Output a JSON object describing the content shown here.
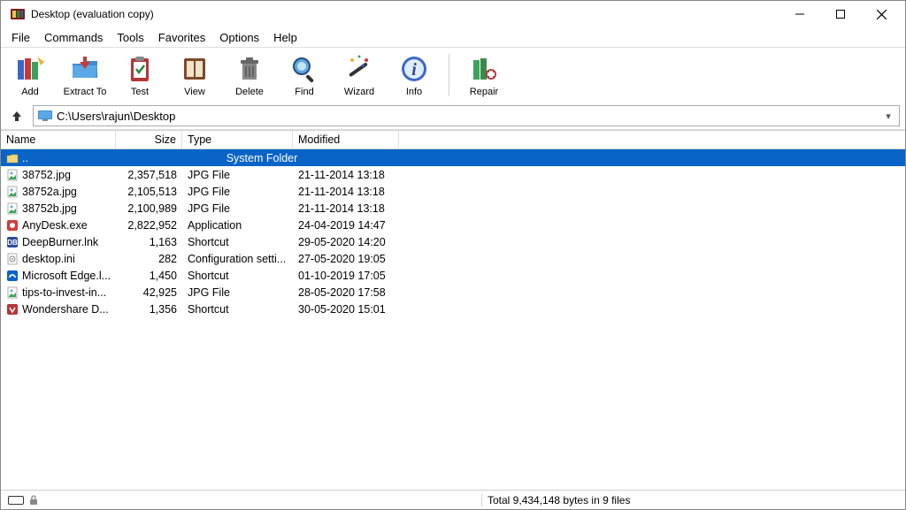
{
  "titlebar": {
    "title": "Desktop (evaluation copy)"
  },
  "menu": {
    "file": "File",
    "commands": "Commands",
    "tools": "Tools",
    "favorites": "Favorites",
    "options": "Options",
    "help": "Help"
  },
  "toolbar": {
    "add": "Add",
    "extract": "Extract To",
    "test": "Test",
    "view": "View",
    "delete": "Delete",
    "find": "Find",
    "wizard": "Wizard",
    "info": "Info",
    "repair": "Repair"
  },
  "path": "C:\\Users\\rajun\\Desktop",
  "columns": {
    "name": "Name",
    "size": "Size",
    "type": "Type",
    "modified": "Modified"
  },
  "parent_row": {
    "name": "..",
    "type": "System Folder"
  },
  "files": [
    {
      "icon": "jpg",
      "name": "38752.jpg",
      "size": "2,357,518",
      "type": "JPG File",
      "modified": "21-11-2014 13:18"
    },
    {
      "icon": "jpg",
      "name": "38752a.jpg",
      "size": "2,105,513",
      "type": "JPG File",
      "modified": "21-11-2014 13:18"
    },
    {
      "icon": "jpg",
      "name": "38752b.jpg",
      "size": "2,100,989",
      "type": "JPG File",
      "modified": "21-11-2014 13:18"
    },
    {
      "icon": "exe-red",
      "name": "AnyDesk.exe",
      "size": "2,822,952",
      "type": "Application",
      "modified": "24-04-2019 14:47"
    },
    {
      "icon": "lnk-blue",
      "name": "DeepBurner.lnk",
      "size": "1,163",
      "type": "Shortcut",
      "modified": "29-05-2020 14:20"
    },
    {
      "icon": "ini",
      "name": "desktop.ini",
      "size": "282",
      "type": "Configuration setti...",
      "modified": "27-05-2020 19:05"
    },
    {
      "icon": "edge",
      "name": "Microsoft Edge.l...",
      "size": "1,450",
      "type": "Shortcut",
      "modified": "01-10-2019 17:05"
    },
    {
      "icon": "jpg",
      "name": "tips-to-invest-in...",
      "size": "42,925",
      "type": "JPG File",
      "modified": "28-05-2020 17:58"
    },
    {
      "icon": "ws-red",
      "name": "Wondershare D...",
      "size": "1,356",
      "type": "Shortcut",
      "modified": "30-05-2020 15:01"
    }
  ],
  "status": "Total 9,434,148 bytes in 9 files"
}
